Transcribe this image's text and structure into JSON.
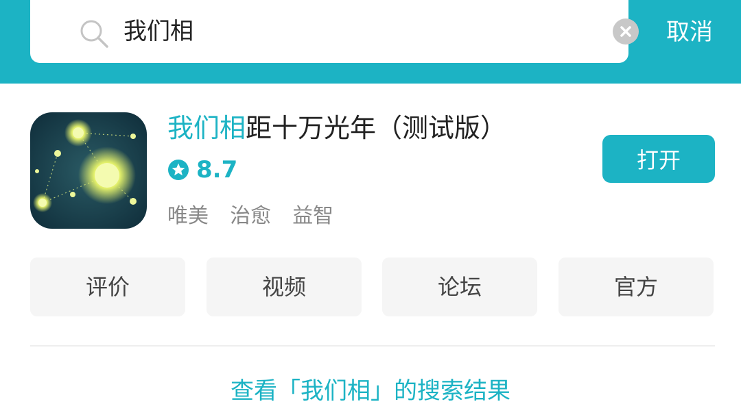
{
  "search": {
    "query": "我们相",
    "cancel_label": "取消"
  },
  "app": {
    "title_highlight": "我们相",
    "title_rest": "距十万光年（测试版）",
    "rating": "8.7",
    "tags": [
      "唯美",
      "治愈",
      "益智"
    ],
    "open_label": "打开"
  },
  "actions": [
    {
      "label": "评价"
    },
    {
      "label": "视频"
    },
    {
      "label": "论坛"
    },
    {
      "label": "官方"
    }
  ],
  "footer": {
    "search_results_label": "查看「我们相」的搜索结果"
  },
  "colors": {
    "accent": "#1cb3c4",
    "background": "#ffffff",
    "button_bg": "#f5f5f5",
    "tag_text": "#888888"
  },
  "icons": {
    "search": "search-icon",
    "clear": "clear-icon",
    "rating": "star-badge-icon",
    "app": "app-icon-starry-night"
  }
}
